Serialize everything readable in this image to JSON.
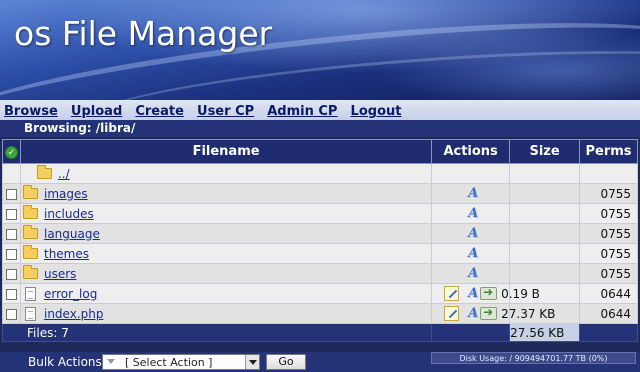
{
  "app": {
    "title": "os File Manager"
  },
  "nav": [
    "Browse",
    "Upload",
    "Create",
    "User CP",
    "Admin CP",
    "Logout"
  ],
  "browsing": {
    "label": "Browsing:",
    "path": "/libra/"
  },
  "table": {
    "headers": {
      "filename": "Filename",
      "actions": "Actions",
      "size": "Size",
      "perms": "Perms"
    },
    "rows": [
      {
        "name": "../",
        "type": "parent",
        "size": "",
        "perms": ""
      },
      {
        "name": "images",
        "type": "folder",
        "size": "",
        "perms": "0755"
      },
      {
        "name": "includes",
        "type": "folder",
        "size": "",
        "perms": "0755"
      },
      {
        "name": "language",
        "type": "folder",
        "size": "",
        "perms": "0755"
      },
      {
        "name": "themes",
        "type": "folder",
        "size": "",
        "perms": "0755"
      },
      {
        "name": "users",
        "type": "folder",
        "size": "",
        "perms": "0755"
      },
      {
        "name": "error_log",
        "type": "file",
        "size": "0.19 B",
        "perms": "0644"
      },
      {
        "name": "index.php",
        "type": "file",
        "size": "27.37 KB",
        "perms": "0644"
      }
    ],
    "footer": {
      "files_label": "Files: 7",
      "total_size": "27.56 KB"
    }
  },
  "bulk": {
    "label": "Bulk Actions:",
    "select_value": "[ Select Action ]",
    "go_label": "Go",
    "disk_usage": "Disk Usage: / 909494701.77 TB (0%)"
  },
  "colors": {
    "header_bar": "#1f2d70",
    "link": "#1a2a9a",
    "nav_text": "#0b1a66"
  },
  "icons": {
    "folder": "folder-icon",
    "file": "file-icon",
    "edit": "edit-icon",
    "rename": "rename-icon",
    "download": "download-icon",
    "select_all": "check-circle-icon"
  }
}
